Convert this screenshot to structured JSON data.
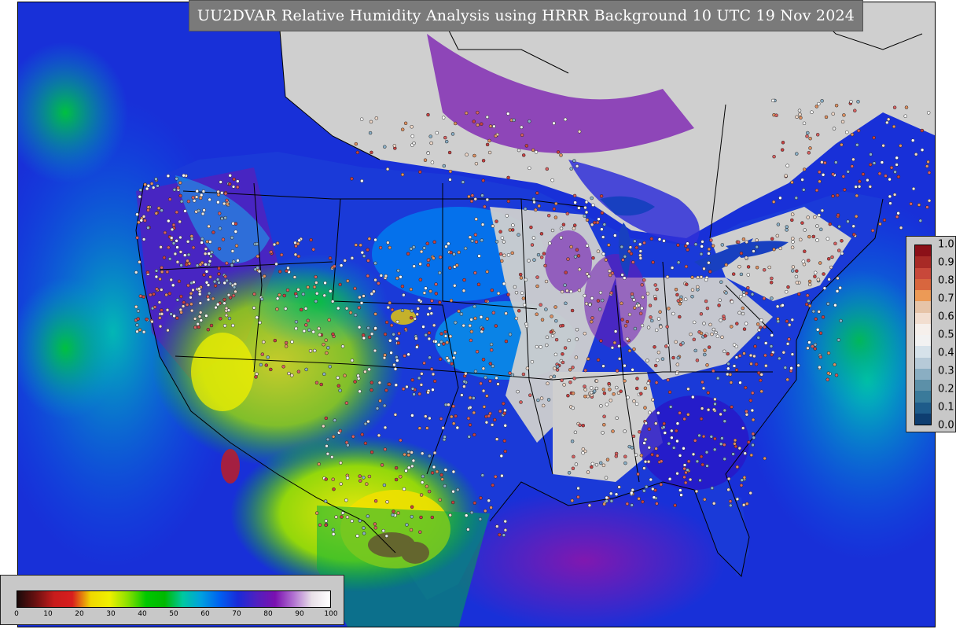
{
  "title": "UU2DVAR Relative Humidity Analysis using HRRR Background 10 UTC 19 Nov 2024",
  "rh_colorbar": {
    "ticks": [
      "0",
      "10",
      "20",
      "30",
      "40",
      "50",
      "60",
      "70",
      "80",
      "90",
      "100"
    ],
    "colors": [
      "#1a0a0a",
      "#6a1010",
      "#c81c1c",
      "#d81e1e",
      "#f0d800",
      "#f0f000",
      "#8ae000",
      "#00c800",
      "#00b800",
      "#00c8a0",
      "#00a0e0",
      "#0060f0",
      "#1a2ad8",
      "#5020c0",
      "#7a10b0",
      "#b070d0",
      "#e8e0e8",
      "#ffffff"
    ]
  },
  "increment_colorbar": {
    "ticks": [
      "1.0",
      "0.9",
      "0.8",
      "0.7",
      "0.6",
      "0.5",
      "0.4",
      "0.3",
      "0.2",
      "0.1",
      "0.0"
    ],
    "colors": [
      "#8c1018",
      "#a82a26",
      "#c8483a",
      "#d8663e",
      "#ec9a56",
      "#e6c4a8",
      "#f2ded0",
      "#f6f0ec",
      "#f2f2f2",
      "#d6e2ea",
      "#b6cad8",
      "#8aaec2",
      "#5c90a8",
      "#3a7a9a",
      "#1e5c8a",
      "#0e3e70"
    ]
  },
  "map": {
    "land_missing_color": "#cfcfcf",
    "ocean_color": "#1b4fd6"
  }
}
